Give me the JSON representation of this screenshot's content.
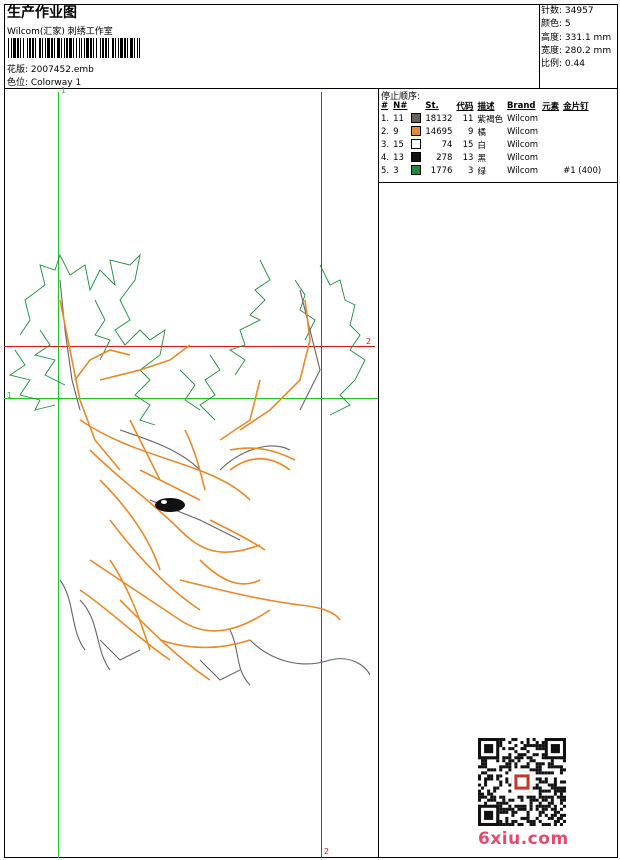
{
  "header": {
    "title": "生产作业图",
    "subtitle": "Wilcom(汇家) 刺绣工作室",
    "design_file": "花版: 2007452.emb",
    "colorway": "色位: Colorway 1"
  },
  "stats": [
    {
      "label": "针数:",
      "value": "34957"
    },
    {
      "label": "颜色:",
      "value": "5"
    },
    {
      "label": "高度:",
      "value": "331.1 mm"
    },
    {
      "label": "宽度:",
      "value": "280.2 mm"
    },
    {
      "label": "比例:",
      "value": "0.44"
    }
  ],
  "sequence": {
    "title": "停止顺序:",
    "headers": [
      "#",
      "N#",
      "",
      "St.",
      "代码",
      "描述",
      "Brand",
      "元素",
      "金片钉"
    ],
    "rows": [
      {
        "idx": "1.",
        "n": "11",
        "color": "#6a6260",
        "st": "18132",
        "code": "11",
        "desc": "紫褐色",
        "brand": "Wilcom",
        "elem": "",
        "seq": ""
      },
      {
        "idx": "2.",
        "n": "9",
        "color": "#e58a2c",
        "st": "14695",
        "code": "9",
        "desc": "橘",
        "brand": "Wilcom",
        "elem": "",
        "seq": ""
      },
      {
        "idx": "3.",
        "n": "15",
        "color": "#ffffff",
        "st": "74",
        "code": "15",
        "desc": "白",
        "brand": "Wilcom",
        "elem": "",
        "seq": ""
      },
      {
        "idx": "4.",
        "n": "13",
        "color": "#111111",
        "st": "278",
        "code": "13",
        "desc": "黑",
        "brand": "Wilcom",
        "elem": "",
        "seq": ""
      },
      {
        "idx": "5.",
        "n": "3",
        "color": "#1f8a3c",
        "st": "1776",
        "code": "3",
        "desc": "绿",
        "brand": "Wilcom",
        "elem": "",
        "seq": "#1 (400)"
      }
    ]
  },
  "guides": {
    "v1_label": "1",
    "v2_label": "2",
    "h1_label": "1",
    "h2_label": "2",
    "green": "#22c422",
    "red": "#e01818"
  },
  "watermark": "6xiu.com"
}
